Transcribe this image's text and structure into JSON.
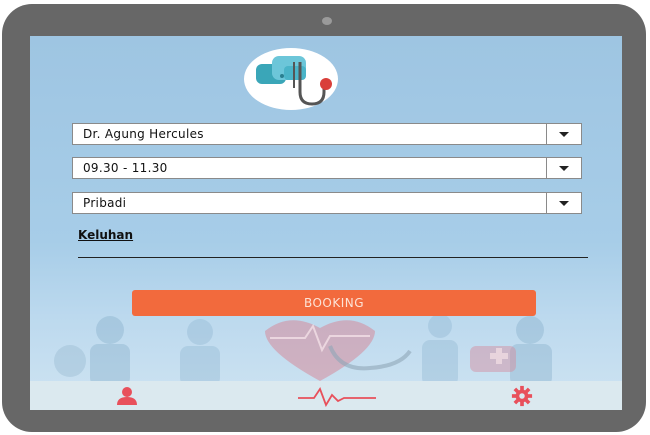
{
  "form": {
    "doctor": "Dr. Agung Hercules",
    "schedule": "09.30 - 11.30",
    "patient_type": "Pribadi",
    "complaint_label": "Keluhan",
    "complaint_value": ""
  },
  "booking_label": "BOOKING",
  "nav": [
    "person-icon",
    "heartbeat-icon",
    "gear-icon"
  ],
  "colors": {
    "accent": "#f26a3d",
    "background": "#a7cde8",
    "navbar": "#dbe9ef",
    "icon": "#e8505b"
  }
}
